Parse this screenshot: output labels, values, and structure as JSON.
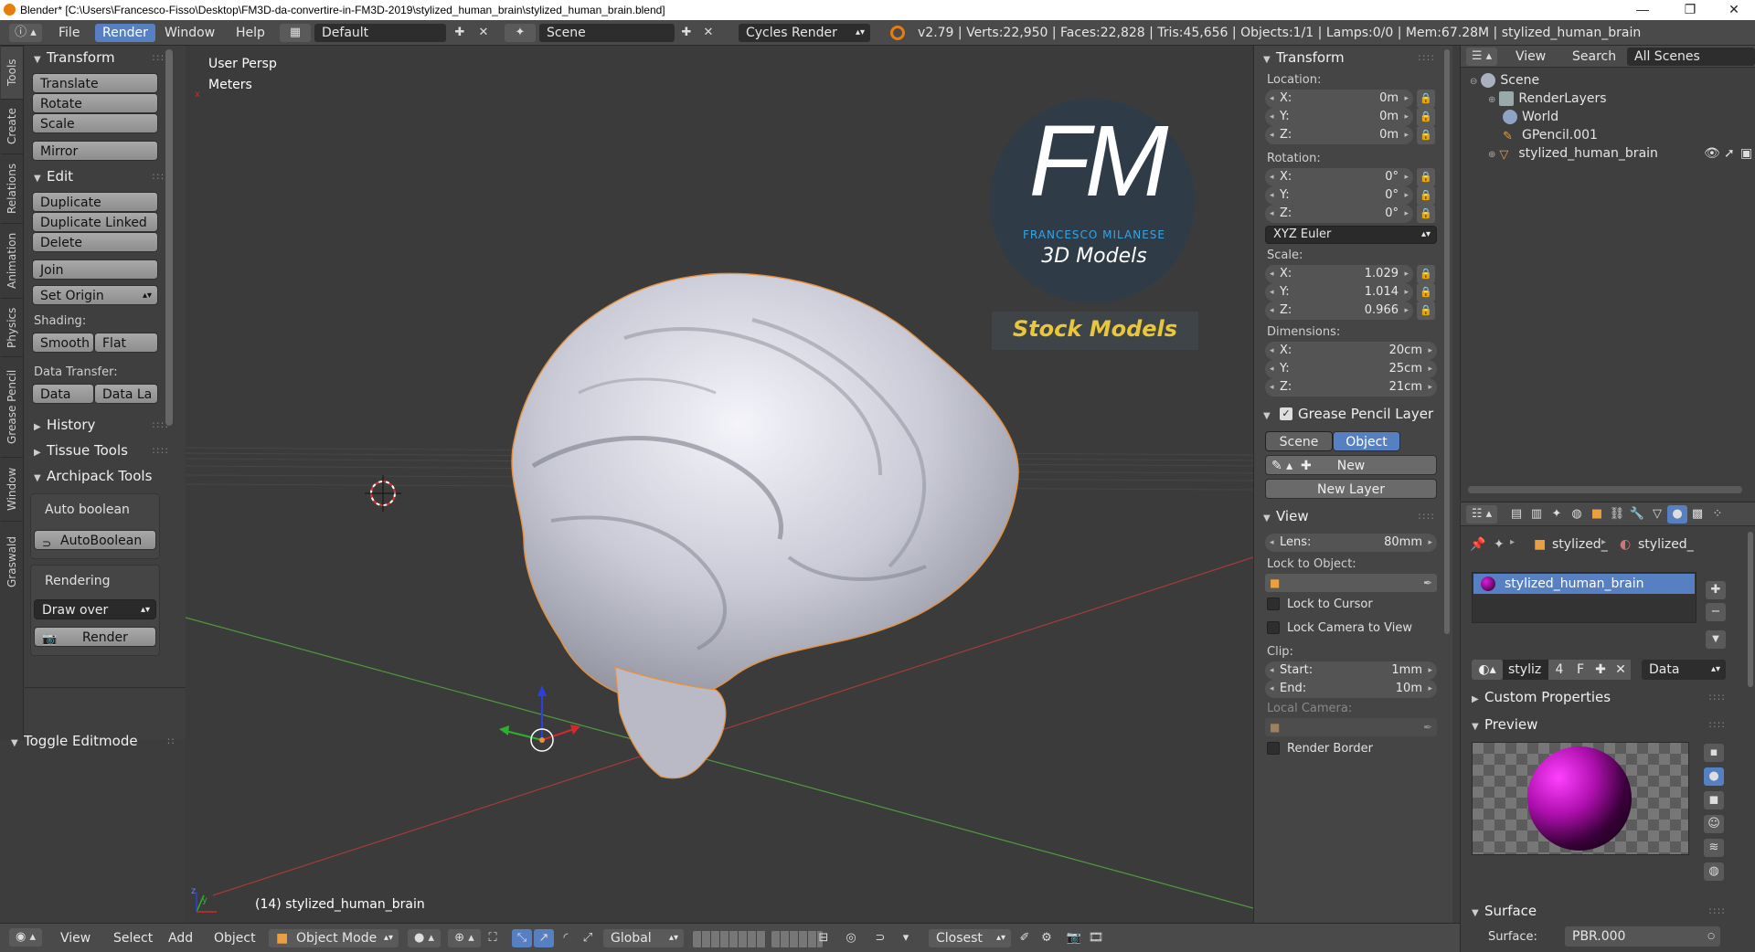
{
  "window": {
    "title": "Blender* [C:\\Users\\Francesco-Fisso\\Desktop\\FM3D-da-convertire-in-FM3D-2019\\stylized_human_brain\\stylized_human_brain.blend]",
    "minimize": "—",
    "maximize": "❐",
    "close": "✕"
  },
  "topbar": {
    "menus": [
      "File",
      "Render",
      "Window",
      "Help"
    ],
    "active_menu": "Render",
    "layout": "Default",
    "scene": "Scene",
    "engine": "Cycles Render",
    "stats": "v2.79 | Verts:22,950 | Faces:22,828 | Tris:45,656 | Objects:1/1 | Lamps:0/0 | Mem:67.28M | stylized_human_brain"
  },
  "tool_tabs": [
    "Tools",
    "Create",
    "Relations",
    "Animation",
    "Physics",
    "Grease Pencil",
    "Window",
    "Graswald"
  ],
  "toolshelf": {
    "transform_header": "Transform",
    "translate": "Translate",
    "rotate": "Rotate",
    "scale": "Scale",
    "mirror": "Mirror",
    "edit_header": "Edit",
    "duplicate": "Duplicate",
    "duplicate_linked": "Duplicate Linked",
    "delete": "Delete",
    "join": "Join",
    "set_origin": "Set Origin",
    "shading_label": "Shading:",
    "smooth": "Smooth",
    "flat": "Flat",
    "data_transfer_label": "Data Transfer:",
    "data": "Data",
    "data_la": "Data La",
    "history": "History",
    "tissue_tools": "Tissue Tools",
    "archipack": "Archipack Tools",
    "auto_boolean_label": "Auto boolean",
    "autoboolean_btn": "AutoBoolean",
    "rendering_label": "Rendering",
    "draw_over": "Draw over",
    "render_btn": "Render",
    "toggle_editmode": "Toggle Editmode"
  },
  "viewport": {
    "view_name": "User Persp",
    "units": "Meters",
    "object_label": "(14) stylized_human_brain",
    "logo_letters": "FM",
    "logo_name": "FRANCESCO MILANESE",
    "logo_sub": "3D Models",
    "stock_label": "Stock Models",
    "axis_x": "x",
    "axis_y": "y",
    "axis_z": "z"
  },
  "npanel": {
    "transform_header": "Transform",
    "location_label": "Location:",
    "location": [
      {
        "axis": "X:",
        "value": "0m"
      },
      {
        "axis": "Y:",
        "value": "0m"
      },
      {
        "axis": "Z:",
        "value": "0m"
      }
    ],
    "rotation_label": "Rotation:",
    "rotation": [
      {
        "axis": "X:",
        "value": "0°"
      },
      {
        "axis": "Y:",
        "value": "0°"
      },
      {
        "axis": "Z:",
        "value": "0°"
      }
    ],
    "rotation_mode": "XYZ Euler",
    "scale_label": "Scale:",
    "scale": [
      {
        "axis": "X:",
        "value": "1.029"
      },
      {
        "axis": "Y:",
        "value": "1.014"
      },
      {
        "axis": "Z:",
        "value": "0.966"
      }
    ],
    "dimensions_label": "Dimensions:",
    "dimensions": [
      {
        "axis": "X:",
        "value": "20cm"
      },
      {
        "axis": "Y:",
        "value": "25cm"
      },
      {
        "axis": "Z:",
        "value": "21cm"
      }
    ],
    "gp_header": "Grease Pencil Layer",
    "scene_btn": "Scene",
    "object_btn": "Object",
    "new_btn": "New",
    "new_layer_btn": "New Layer",
    "view_header": "View",
    "lens_label": "Lens:",
    "lens_value": "80mm",
    "lock_to_object": "Lock to Object:",
    "lock_to_cursor": "Lock to Cursor",
    "lock_camera": "Lock Camera to View",
    "clip_label": "Clip:",
    "clip_start_label": "Start:",
    "clip_start": "1mm",
    "clip_end_label": "End:",
    "clip_end": "10m",
    "local_camera": "Local Camera:",
    "render_border": "Render Border"
  },
  "outliner": {
    "view_menu": "View",
    "search_menu": "Search",
    "filter": "All Scenes",
    "items": [
      "Scene",
      "RenderLayers",
      "World",
      "GPencil.001",
      "stylized_human_brain"
    ]
  },
  "properties": {
    "crumb1": "stylized_",
    "crumb2": "stylized_",
    "material_slot": "stylized_human_brain",
    "mat_name": "styliz",
    "mat_users": "4",
    "fake_user": "F",
    "data_dropdown": "Data",
    "custom_props": "Custom Properties",
    "preview_header": "Preview",
    "surface_header": "Surface",
    "surface_label": "Surface:",
    "surface_value": "PBR.000"
  },
  "bottombar": {
    "view": "View",
    "select": "Select",
    "add": "Add",
    "object": "Object",
    "mode": "Object Mode",
    "orientation": "Global",
    "snap": "Closest"
  },
  "colors": {
    "accent": "#5680c2",
    "logo_bg": "#2f3c48",
    "logo_fm": "#ffffff",
    "logo_name": "#3aa3e0",
    "stock_text": "#e8c73a",
    "selection_outline": "#e8903c"
  }
}
